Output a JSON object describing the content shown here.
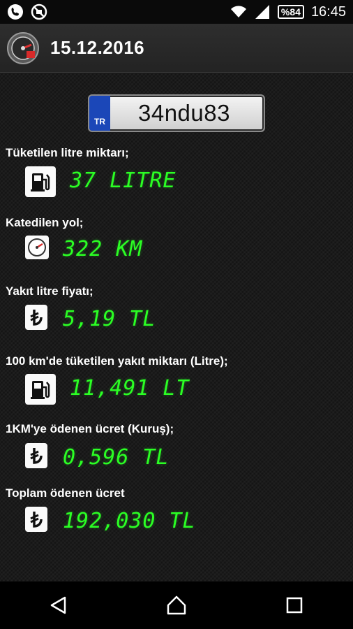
{
  "status_bar": {
    "time": "16:45",
    "battery": "%84",
    "icons": [
      "call-icon",
      "blocked-icon",
      "wifi-icon",
      "signal-icon"
    ]
  },
  "app_bar": {
    "title": "15.12.2016",
    "logo_icon": "speedometer-logo-icon"
  },
  "plate": {
    "country": "TR",
    "number": "34ndu83"
  },
  "items": [
    {
      "label": "Tüketilen litre miktarı;",
      "icon": "fuel-pump-icon",
      "value": "37 LITRE"
    },
    {
      "label": "Katedilen yol;",
      "icon": "speedometer-icon",
      "value": "322 KM"
    },
    {
      "label": "Yakıt litre fiyatı;",
      "icon": "lira-icon",
      "value": "5,19 TL"
    },
    {
      "label": "100 km'de tüketilen yakıt miktarı (Litre);",
      "icon": "fuel-pump-icon",
      "value": "11,491 LT"
    },
    {
      "label": "1KM'ye ödenen ücret (Kuruş);",
      "icon": "lira-icon",
      "value": "0,596 TL"
    },
    {
      "label": "Toplam ödenen ücret",
      "icon": "lira-icon",
      "value": "192,030 TL"
    }
  ],
  "colors": {
    "value_green": "#2bff24",
    "plate_country_blue": "#1b47b8"
  },
  "nav": {
    "icons": [
      "back-icon",
      "home-icon",
      "recents-icon"
    ]
  }
}
